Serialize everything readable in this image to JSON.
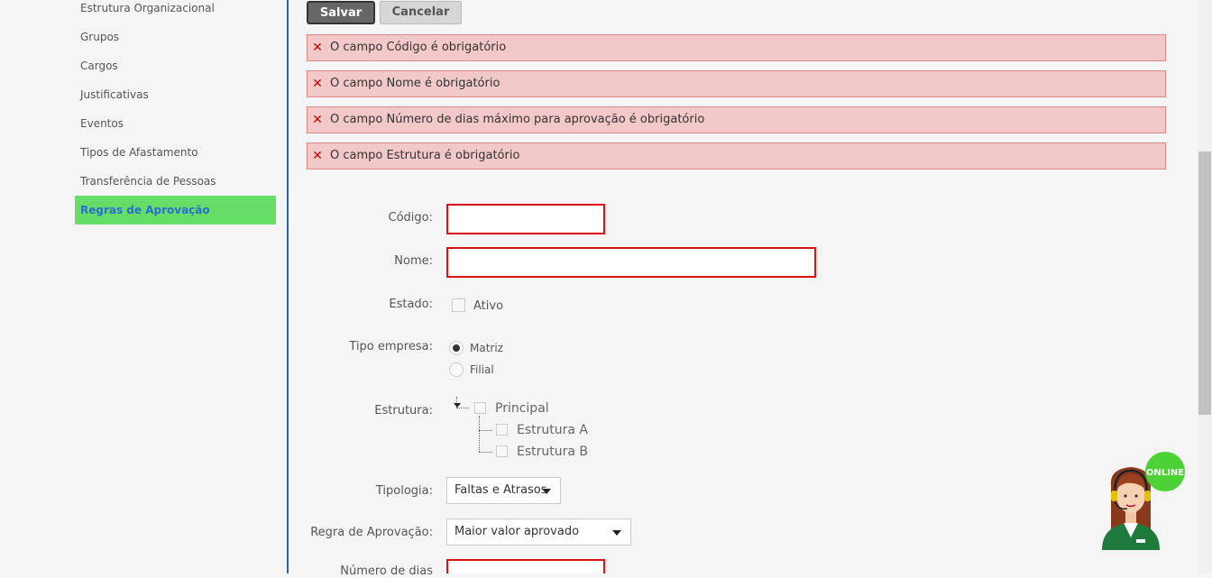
{
  "sidebar": {
    "items": [
      {
        "label": "Estrutura Organizacional"
      },
      {
        "label": "Grupos"
      },
      {
        "label": "Cargos"
      },
      {
        "label": "Justificativas"
      },
      {
        "label": "Eventos"
      },
      {
        "label": "Tipos de Afastamento"
      },
      {
        "label": "Transferência de Pessoas"
      },
      {
        "label": "Regras de Aprovação",
        "active": true
      }
    ]
  },
  "toolbar": {
    "save_label": "Salvar",
    "cancel_label": "Cancelar"
  },
  "errors": [
    "O campo Código é obrigatório",
    "O campo Nome é obrigatório",
    "O campo Número de dias máximo para aprovação é obrigatório",
    "O campo Estrutura é obrigatório"
  ],
  "form": {
    "codigo": {
      "label": "Código:",
      "value": ""
    },
    "nome": {
      "label": "Nome:",
      "value": ""
    },
    "estado": {
      "label": "Estado:",
      "option": "Ativo",
      "checked": false
    },
    "tipo_empresa": {
      "label": "Tipo empresa:",
      "options": [
        "Matriz",
        "Filial"
      ],
      "selected": "Matriz"
    },
    "estrutura": {
      "label": "Estrutura:",
      "root": "Principal",
      "children": [
        "Estrutura A",
        "Estrutura B"
      ]
    },
    "tipologia": {
      "label": "Tipologia:",
      "value": "Faltas e Atrasos"
    },
    "regra_aprovacao": {
      "label": "Regra de Aprovação:",
      "value": "Maior valor aprovado"
    },
    "numero_dias": {
      "label": "Número de dias",
      "value": ""
    }
  },
  "chat_widget": {
    "status": "ONLINE",
    "icon": "support-agent-icon",
    "badge_color": "#4cd137"
  },
  "colors": {
    "accent_active": "#66dd66",
    "error_bg": "#f2c8c8",
    "error_x": "#cc0000",
    "invalid_border": "#dd1111"
  }
}
